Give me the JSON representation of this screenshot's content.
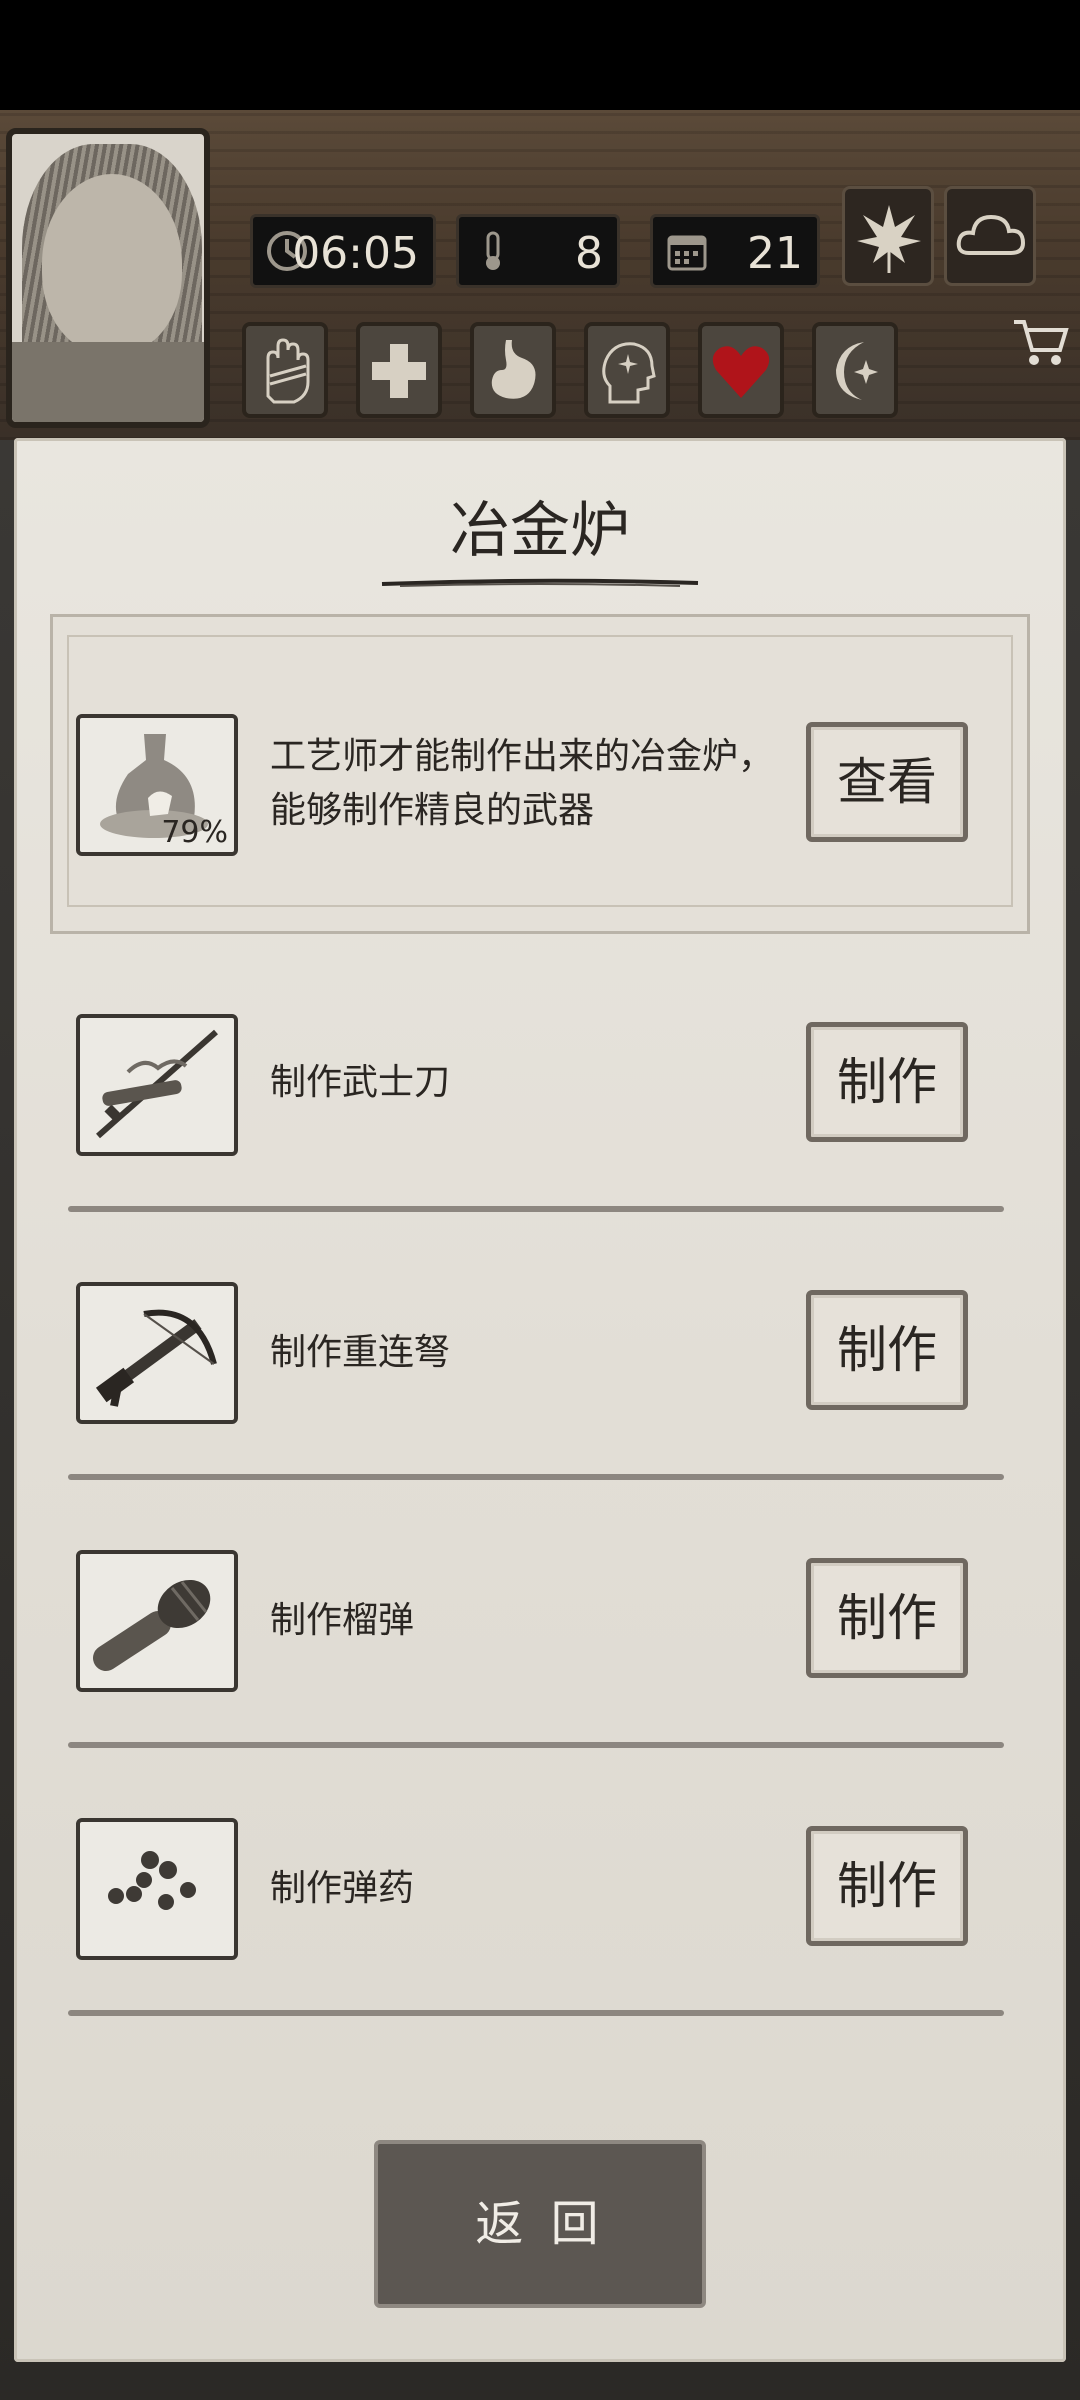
{
  "hud": {
    "time": "06:05",
    "temperature": "8",
    "day": "21",
    "weather_icon": "cloud-icon",
    "season_icon": "leaf-icon",
    "status_icons": [
      "hand-bandage-icon",
      "plus-icon",
      "stomach-icon",
      "head-sparkle-icon",
      "heart-icon",
      "moon-star-icon"
    ]
  },
  "panel": {
    "title": "冶金炉",
    "featured": {
      "description_line1": "工艺师才能制作出来的冶金炉，",
      "description_line2": "能够制作精良的武器",
      "progress": "79%",
      "button": "查看"
    },
    "recipes": [
      {
        "label": "制作武士刀",
        "button": "制作",
        "icon": "katana-icon"
      },
      {
        "label": "制作重连弩",
        "button": "制作",
        "icon": "crossbow-icon"
      },
      {
        "label": "制作榴弹",
        "button": "制作",
        "icon": "grenade-icon"
      },
      {
        "label": "制作弹药",
        "button": "制作",
        "icon": "ammo-icon"
      }
    ]
  },
  "footer": {
    "back": "返 回"
  },
  "colors": {
    "paper": "#e6e2da",
    "heart_red": "#b0141a",
    "button_border": "#6f6860"
  }
}
